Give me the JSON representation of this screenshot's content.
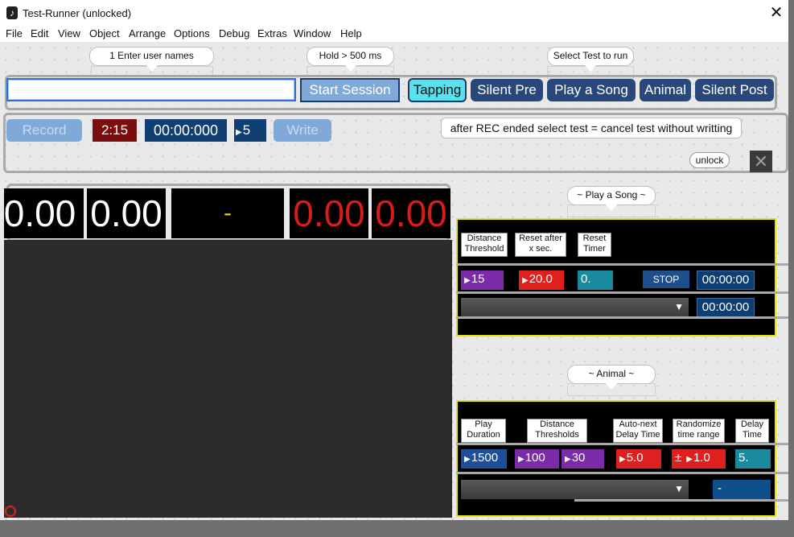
{
  "window": {
    "title": "Test-Runner (unlocked)",
    "close_glyph": "✕"
  },
  "menu": [
    "File",
    "Edit",
    "View",
    "Object",
    "Arrange",
    "Options",
    "Debug",
    "Extras",
    "Window",
    "Help"
  ],
  "comments": {
    "user_names": "1 Enter user names",
    "hold": "Hold > 500 ms",
    "select_test": "Select Test to run",
    "rec_note": "after REC ended select test = cancel test without writting",
    "play_song": "~ Play a Song ~",
    "animal": "~ Animal ~"
  },
  "session": {
    "user_input_value": "",
    "start_label": "Start Session"
  },
  "tests": [
    "Tapping",
    "Silent Pre",
    "Play a Song",
    "Animal",
    "Silent Post"
  ],
  "record_bar": {
    "record_label": "Record",
    "duration": "2:15",
    "timer": "00:00:000",
    "count": "5",
    "write_label": "Write"
  },
  "unlock_label": "unlock",
  "displays": {
    "d1": "0.00",
    "d2": "0.00",
    "center": "-",
    "d3": "0.00",
    "d4": "0.00"
  },
  "play_song_panel": {
    "labels": [
      "Distance\nThreshold",
      "Reset after\nx sec.",
      "Reset\nTimer"
    ],
    "distance_threshold": "15",
    "reset_after": "20.0",
    "reset_timer": "0.",
    "stop_label": "STOP",
    "time1": "00:00:00",
    "time2": "00:00:00",
    "dropdown_value": ""
  },
  "animal_panel": {
    "labels": [
      "Play\nDuration",
      "Distance\nThresholds",
      "Auto-next\nDelay Time",
      "Randomize\ntime range",
      "Delay\nTime"
    ],
    "play_duration": "1500",
    "threshold_a": "100",
    "threshold_b": "30",
    "auto_next": "5.0",
    "pm_glyph": "±",
    "randomize": "1.0",
    "delay_time": "5.",
    "dropdown_value": "",
    "output": "-"
  },
  "colors": {
    "purple": "#7b2aa8",
    "red": "#e0201f",
    "teal": "#1a8a9e",
    "navy": "#1f4f8a",
    "yellow": "#e8e200",
    "cyan": "#58e2f0"
  },
  "icons": {
    "close": "close-icon",
    "app": "max-app-icon",
    "dropdown": "chevron-down-icon"
  }
}
